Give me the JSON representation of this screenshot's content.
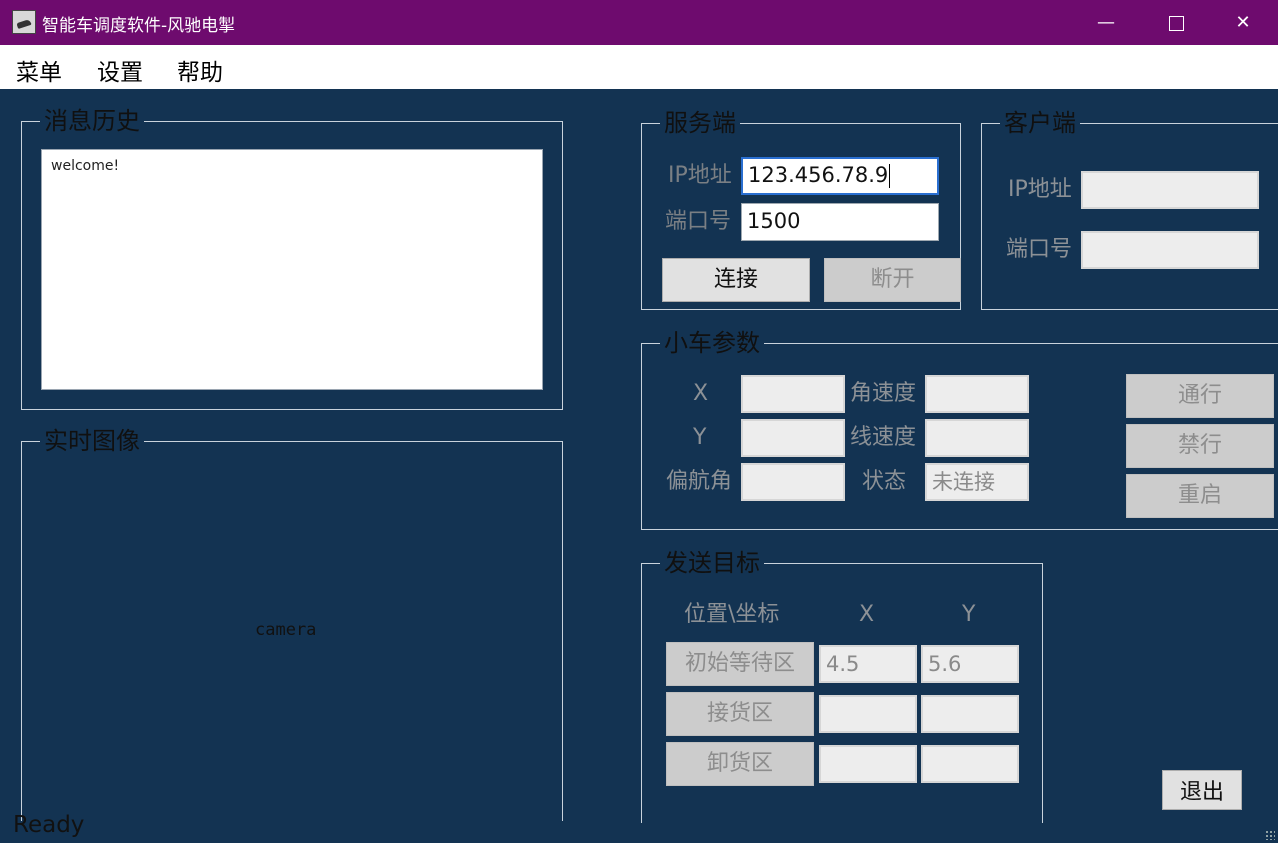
{
  "window": {
    "title": "智能车调度软件-风驰电掣",
    "minimize_glyph": "—",
    "close_glyph": "✕"
  },
  "menu": {
    "items": [
      "菜单",
      "设置",
      "帮助"
    ]
  },
  "message_history": {
    "title": "消息历史",
    "text": "welcome!"
  },
  "camera": {
    "title": "实时图像",
    "placeholder": "camera"
  },
  "server": {
    "title": "服务端",
    "ip_label": "IP地址",
    "ip_value": "123.456.78.9",
    "port_label": "端口号",
    "port_value": "1500",
    "connect_button": "连接",
    "disconnect_button": "断开"
  },
  "client": {
    "title": "客户端",
    "ip_label": "IP地址",
    "ip_value": "",
    "port_label": "端口号",
    "port_value": ""
  },
  "car_params": {
    "title": "小车参数",
    "x_label": "X",
    "y_label": "Y",
    "yaw_label": "偏航角",
    "angular_speed_label": "角速度",
    "linear_speed_label": "线速度",
    "state_label": "状态",
    "x_value": "",
    "y_value": "",
    "yaw_value": "",
    "angular_speed_value": "",
    "linear_speed_value": "",
    "state_value": "未连接",
    "pass_button": "通行",
    "stop_button": "禁行",
    "restart_button": "重启"
  },
  "send_target": {
    "title": "发送目标",
    "col_position": "位置\\坐标",
    "col_x": "X",
    "col_y": "Y",
    "rows": [
      {
        "label": "初始等待区",
        "x": "4.5",
        "y": "5.6"
      },
      {
        "label": "接货区",
        "x": "",
        "y": ""
      },
      {
        "label": "卸货区",
        "x": "",
        "y": ""
      }
    ]
  },
  "exit_button": "退出",
  "status_text": "Ready"
}
